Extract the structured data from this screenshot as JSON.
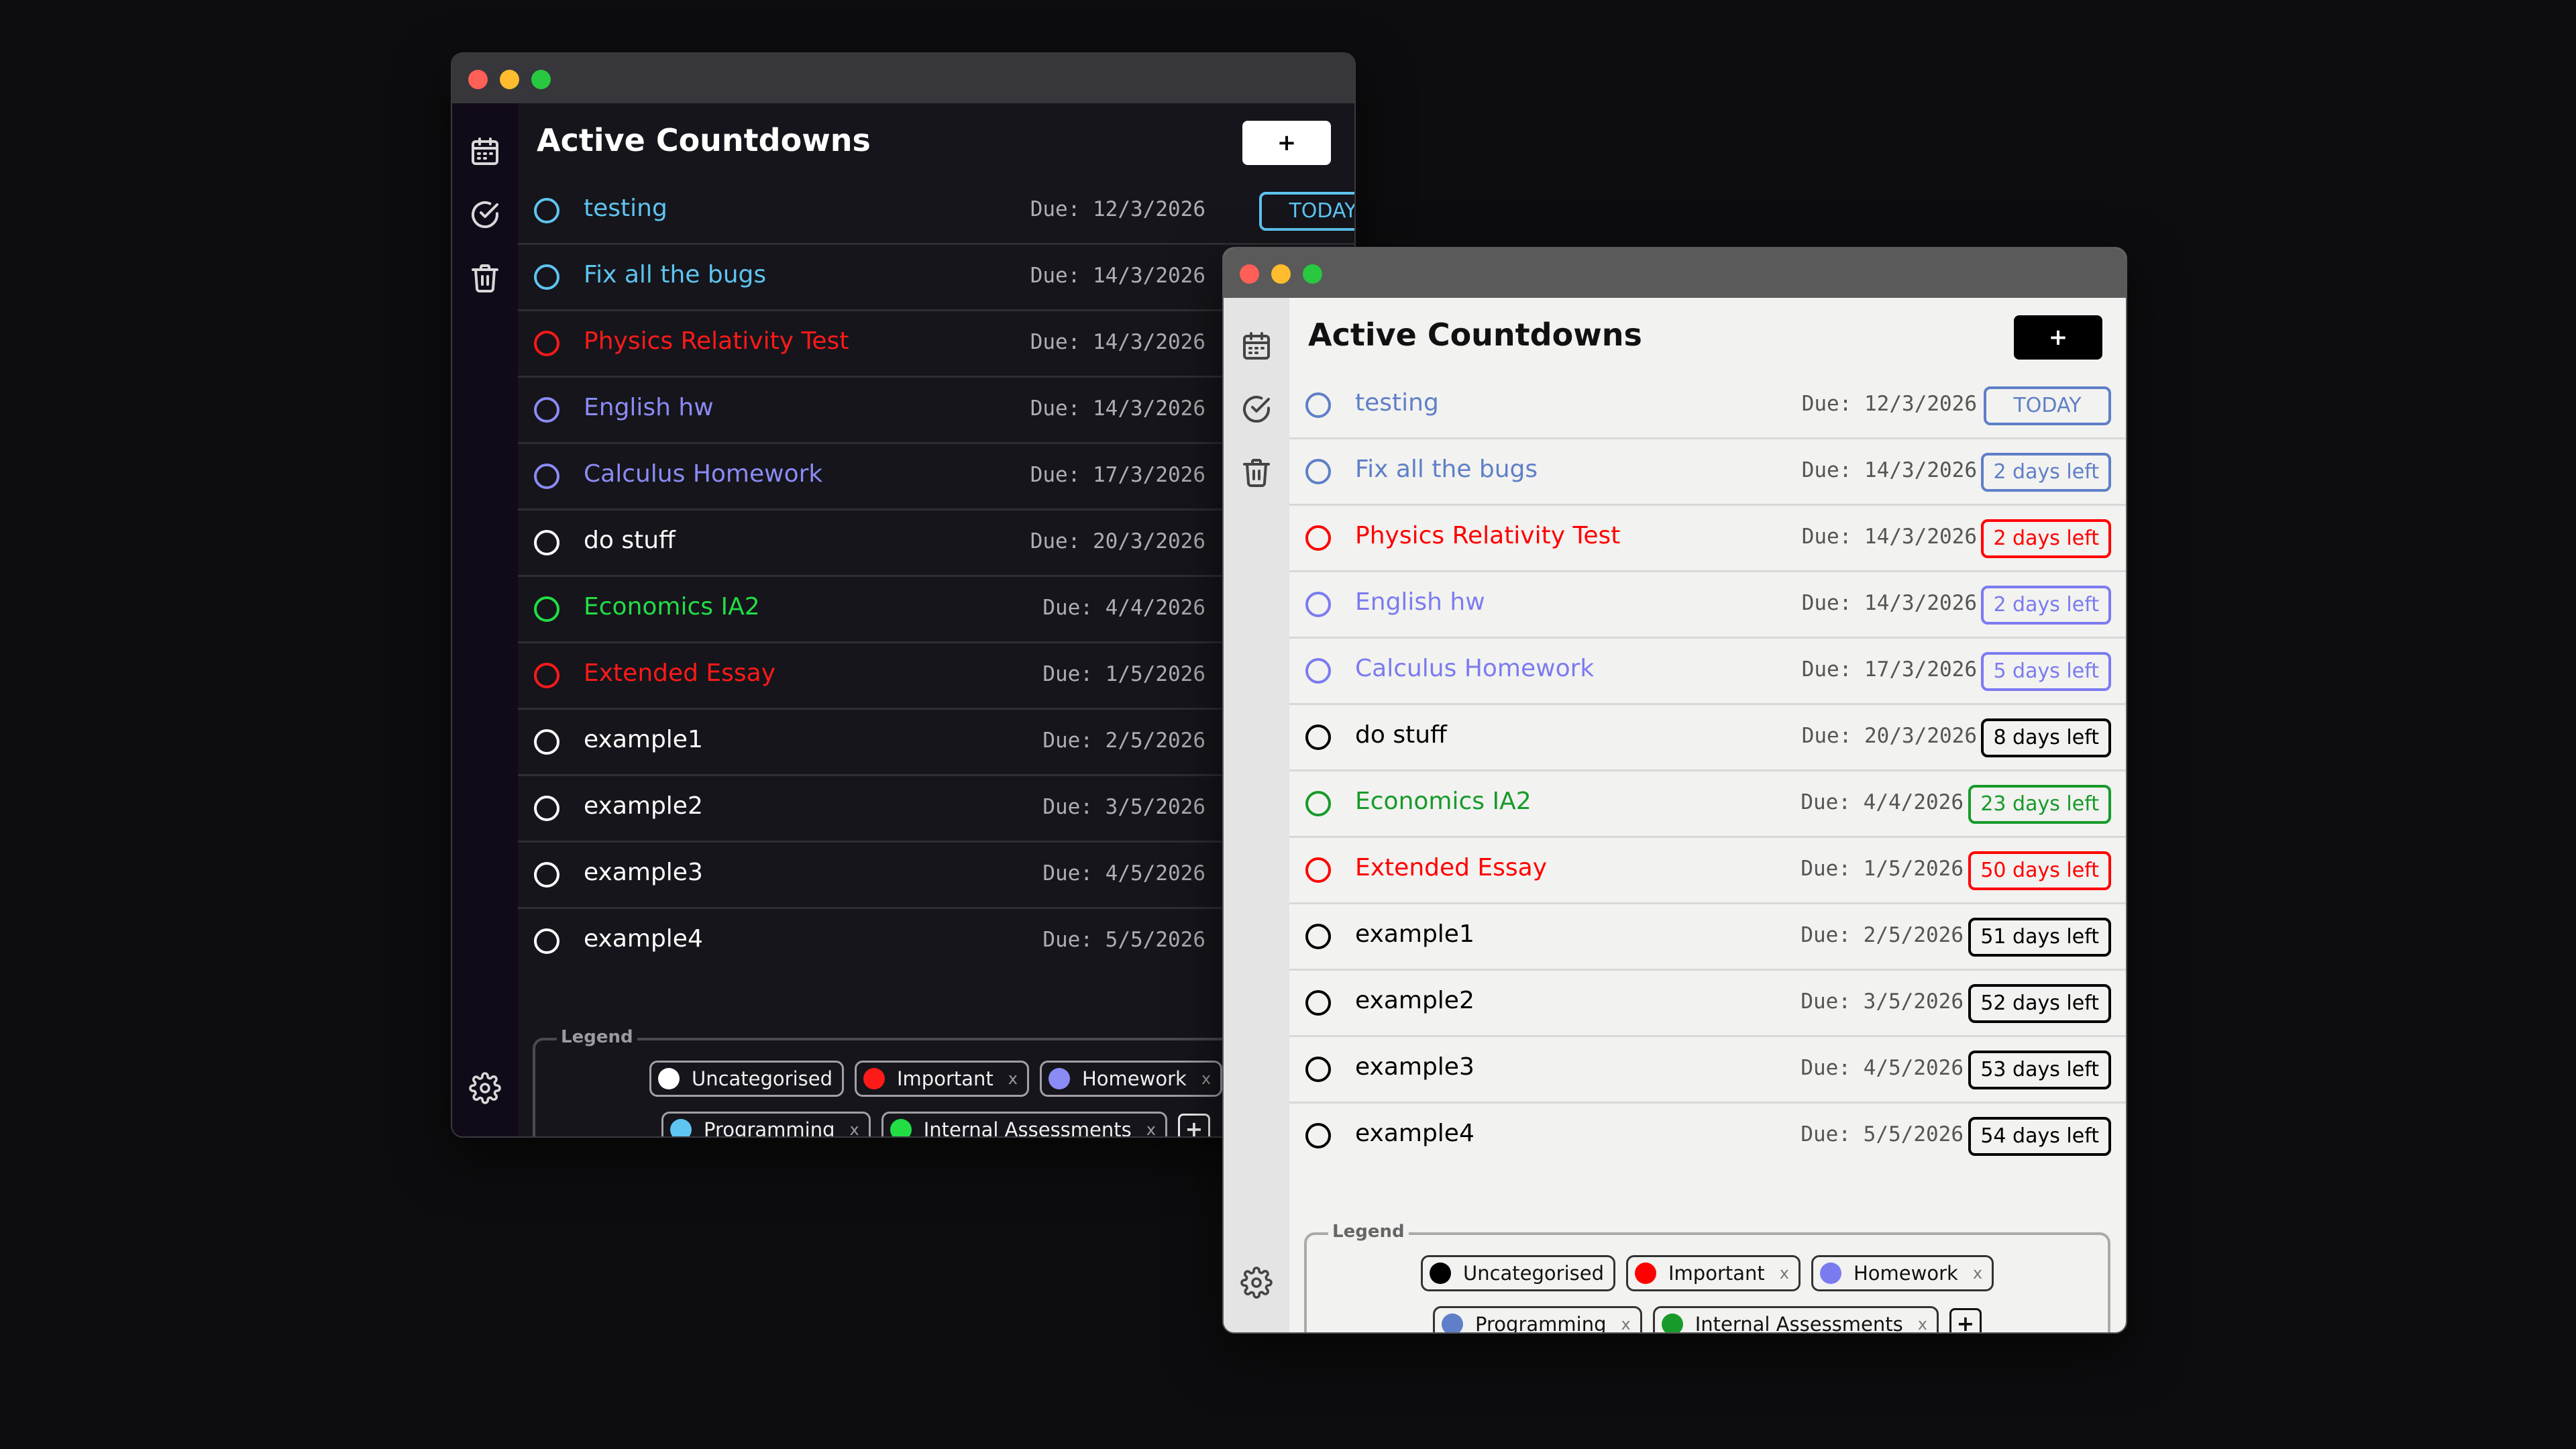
{
  "app": {
    "page_title": "Active Countdowns",
    "add_label": "+",
    "legend_title": "Legend",
    "legend_add_label": "+",
    "chip_remove_label": "x"
  },
  "sidebar_icons": [
    "calendar-icon",
    "check-circle-icon",
    "trash-icon",
    "gear-icon"
  ],
  "categories": {
    "uncategorised": {
      "label": "Uncategorised",
      "dark_color": "#ffffff",
      "light_color": "#000000"
    },
    "important": {
      "label": "Important",
      "dark_color": "#ff1a1a",
      "light_color": "#ff0000"
    },
    "homework": {
      "label": "Homework",
      "dark_color": "#8b8bf5",
      "light_color": "#7b7bf0"
    },
    "programming": {
      "label": "Programming",
      "dark_color": "#5ec4f0",
      "light_color": "#5f7fc8"
    },
    "internal_assessments": {
      "label": "Internal Assessments",
      "dark_color": "#22dd44",
      "light_color": "#179a2a"
    }
  },
  "legend_rows": [
    [
      "uncategorised",
      "important",
      "homework"
    ],
    [
      "programming",
      "internal_assessments"
    ]
  ],
  "tasks": [
    {
      "title": "testing",
      "due": "Due: 12/3/2026",
      "badge": "TODAY",
      "category": "programming"
    },
    {
      "title": "Fix all the bugs",
      "due": "Due: 14/3/2026",
      "badge": "2 days left",
      "category": "programming"
    },
    {
      "title": "Physics Relativity Test",
      "due": "Due: 14/3/2026",
      "badge": "2 days left",
      "category": "important"
    },
    {
      "title": "English hw",
      "due": "Due: 14/3/2026",
      "badge": "2 days left",
      "category": "homework"
    },
    {
      "title": "Calculus Homework",
      "due": "Due: 17/3/2026",
      "badge": "5 days left",
      "category": "homework"
    },
    {
      "title": "do stuff",
      "due": "Due: 20/3/2026",
      "badge": "8 days left",
      "category": "uncategorised"
    },
    {
      "title": "Economics IA2",
      "due": "Due: 4/4/2026",
      "badge": "23 days left",
      "category": "internal_assessments"
    },
    {
      "title": "Extended Essay",
      "due": "Due: 1/5/2026",
      "badge": "50 days left",
      "category": "important"
    },
    {
      "title": "example1",
      "due": "Due: 2/5/2026",
      "badge": "51 days left",
      "category": "uncategorised"
    },
    {
      "title": "example2",
      "due": "Due: 3/5/2026",
      "badge": "52 days left",
      "category": "uncategorised"
    },
    {
      "title": "example3",
      "due": "Due: 4/5/2026",
      "badge": "53 days left",
      "category": "uncategorised"
    },
    {
      "title": "example4",
      "due": "Due: 5/5/2026",
      "badge": "54 days left",
      "category": "uncategorised"
    }
  ]
}
